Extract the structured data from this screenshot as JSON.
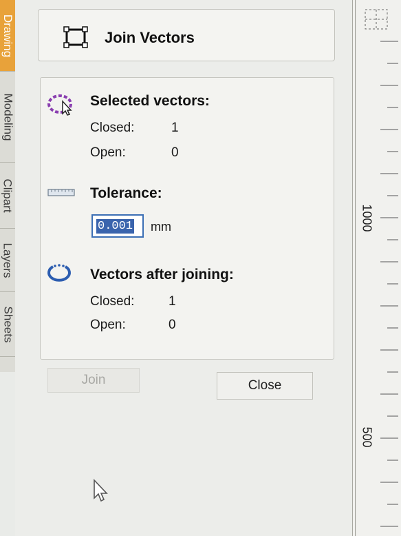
{
  "tabs": [
    {
      "label": "Drawing",
      "active": true
    },
    {
      "label": "Modeling",
      "active": false
    },
    {
      "label": "Clipart",
      "active": false
    },
    {
      "label": "Layers",
      "active": false
    },
    {
      "label": "Sheets",
      "active": false
    }
  ],
  "header": {
    "title": "Join Vectors",
    "icon": "join-vectors-icon"
  },
  "selected": {
    "heading": "Selected vectors:",
    "closed_label": "Closed:",
    "closed_value": "1",
    "open_label": "Open:",
    "open_value": "0"
  },
  "tolerance": {
    "heading": "Tolerance:",
    "value": "0.001",
    "unit": "mm"
  },
  "after": {
    "heading": "Vectors after joining:",
    "closed_label": "Closed:",
    "closed_value": "1",
    "open_label": "Open:",
    "open_value": "0"
  },
  "buttons": {
    "join": "Join",
    "close": "Close"
  },
  "ruler": {
    "labels": [
      "1000",
      "500"
    ]
  },
  "colors": {
    "active_tab": "#e8a23a",
    "selection": "#3a64ad",
    "accent": "#8a3fb0"
  }
}
